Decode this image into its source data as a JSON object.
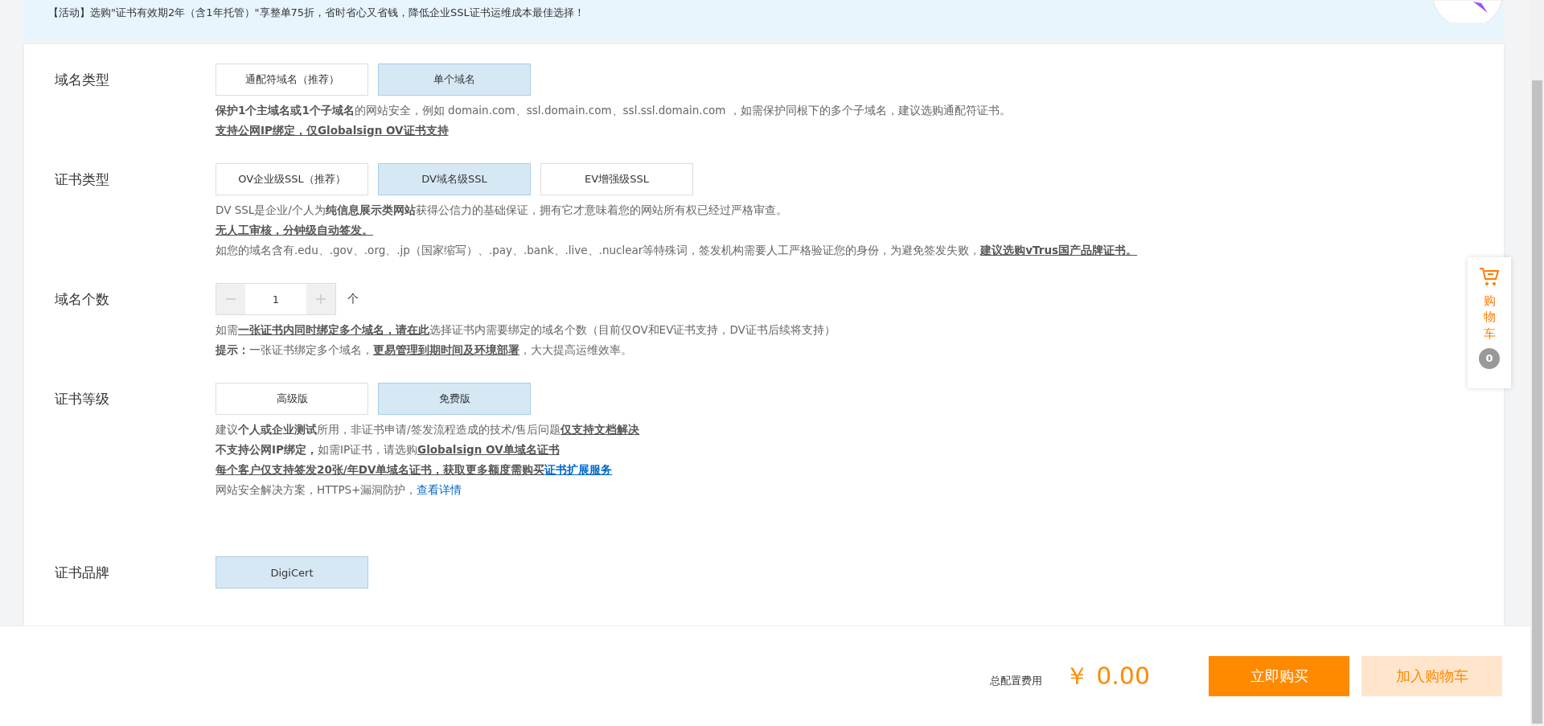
{
  "banner": {
    "text": "【活动】选购\"证书有效期2年（含1年托管）\"享整单75折，省时省心又省钱，降低企业SSL证书运维成本最佳选择！"
  },
  "sections": [
    {
      "label": "域名类型",
      "kind": "options",
      "options": [
        {
          "label": "通配符域名（推荐）",
          "selected": false
        },
        {
          "label": "单个域名",
          "selected": true
        }
      ],
      "description": [
        [
          {
            "kind": "bold",
            "text": "保护1个主域名或1个子域名"
          },
          {
            "kind": "plain",
            "text": "的网站安全，例如 domain.com、ssl.domain.com、ssl.ssl.domain.com ，如需保护同根下的多个子域名，建议选购通配符证书。"
          }
        ],
        [
          {
            "kind": "link",
            "text": "支持公网IP绑定，仅Globalsign OV证书支持"
          }
        ]
      ]
    },
    {
      "label": "证书类型",
      "kind": "options",
      "options": [
        {
          "label": "OV企业级SSL（推荐）",
          "selected": false
        },
        {
          "label": "DV域名级SSL",
          "selected": true
        },
        {
          "label": "EV增强级SSL",
          "selected": false
        }
      ],
      "description": [
        [
          {
            "kind": "plain",
            "text": "DV SSL是企业/个人为"
          },
          {
            "kind": "bold",
            "text": "纯信息展示类网站"
          },
          {
            "kind": "plain",
            "text": "获得公信力的基础保证，拥有它才意味着您的网站所有权已经过严格审查。"
          }
        ],
        [
          {
            "kind": "link",
            "text": "无人工审核，分钟级自动签发。"
          }
        ],
        [
          {
            "kind": "plain",
            "text": "如您的域名含有.edu、.gov、.org、.jp（国家缩写）、.pay、.bank、.live、.nuclear等特殊词，签发机构需要人工严格验证您的身份，为避免签发失败，"
          },
          {
            "kind": "link",
            "text": "建议选购vTrus国产品牌证书。"
          }
        ]
      ]
    },
    {
      "label": "域名个数",
      "kind": "stepper",
      "stepper": {
        "value": "1",
        "unit": "个"
      },
      "description": [
        [
          {
            "kind": "plain",
            "text": "如需"
          },
          {
            "kind": "link",
            "text": "一张证书内同时绑定多个域名，请在此"
          },
          {
            "kind": "plain",
            "text": "选择证书内需要绑定的域名个数（目前仅OV和EV证书支持，DV证书后续将支持）"
          }
        ],
        [
          {
            "kind": "bold",
            "text": "提示："
          },
          {
            "kind": "plain",
            "text": "一张证书绑定多个域名，"
          },
          {
            "kind": "link",
            "text": "更易管理到期时间及环境部署"
          },
          {
            "kind": "plain",
            "text": "，大大提高运维效率。"
          }
        ]
      ]
    },
    {
      "label": "证书等级",
      "kind": "options",
      "options": [
        {
          "label": "高级版",
          "selected": false
        },
        {
          "label": "免费版",
          "selected": true
        }
      ],
      "description": [
        [
          {
            "kind": "plain",
            "text": "建议"
          },
          {
            "kind": "bold",
            "text": "个人或企业测试"
          },
          {
            "kind": "plain",
            "text": "所用，非证书申请/签发流程造成的技术/售后问题"
          },
          {
            "kind": "link",
            "text": "仅支持文档解决"
          }
        ],
        [
          {
            "kind": "bold",
            "text": "不支持公网IP绑定，"
          },
          {
            "kind": "plain",
            "text": "如需IP证书，请选购"
          },
          {
            "kind": "link",
            "text": "Globalsign OV单域名证书"
          }
        ],
        [
          {
            "kind": "link",
            "text": "每个客户仅支持签发20张/年DV单域名证书，获取更多额度需购买"
          },
          {
            "kind": "bluelink",
            "text": "证书扩展服务"
          }
        ],
        [
          {
            "kind": "plain",
            "text": "网站安全解决方案，HTTPS+漏洞防护，"
          },
          {
            "kind": "blue",
            "text": "查看详情"
          }
        ]
      ]
    },
    {
      "label": "证书品牌",
      "kind": "options",
      "options": [
        {
          "label": "DigiCert",
          "selected": true
        }
      ]
    }
  ],
  "cart": {
    "label": "购物车",
    "count": "0"
  },
  "footer": {
    "total_label": "总配置费用",
    "price": "￥ 0.00",
    "buttons": [
      {
        "label": "立即购买",
        "kind": "primary"
      },
      {
        "label": "加入购物车",
        "kind": "secondary"
      }
    ]
  }
}
